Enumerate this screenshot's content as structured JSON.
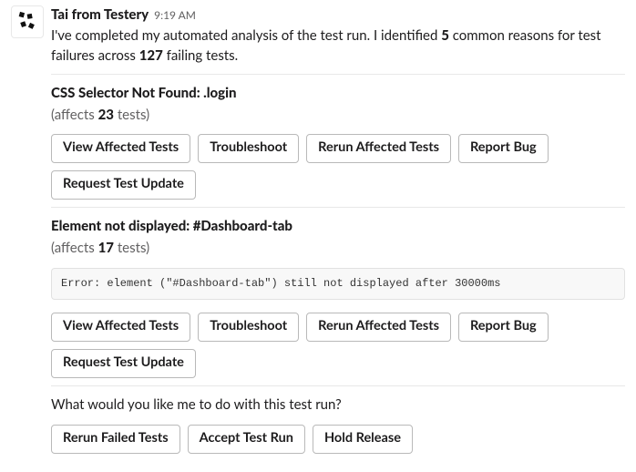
{
  "header": {
    "sender": "Tai from Testery",
    "timestamp": "9:19 AM"
  },
  "summary": {
    "prefix": "I've completed my automated analysis of the test run. I identified ",
    "reason_count": "5",
    "mid": " common reasons for test failures across ",
    "failing_count": "127",
    "suffix": " failing tests."
  },
  "section1": {
    "title": "CSS Selector Not Found: .login",
    "affects_prefix": "(affects ",
    "affects_count": "23",
    "affects_suffix": " tests)",
    "buttons": {
      "view": "View Affected Tests",
      "troubleshoot": "Troubleshoot",
      "rerun": "Rerun Affected Tests",
      "report": "Report Bug",
      "request": "Request Test Update"
    }
  },
  "section2": {
    "title": "Element not displayed: #Dashboard-tab",
    "affects_prefix": "(affects ",
    "affects_count": "17",
    "affects_suffix": " tests)",
    "error": "Error: element (\"#Dashboard-tab\") still not displayed after 30000ms",
    "buttons": {
      "view": "View Affected Tests",
      "troubleshoot": "Troubleshoot",
      "rerun": "Rerun Affected Tests",
      "report": "Report Bug",
      "request": "Request Test Update"
    }
  },
  "footer": {
    "question": "What would you like me to do with this test run?",
    "buttons": {
      "rerun_failed": "Rerun Failed Tests",
      "accept": "Accept Test Run",
      "hold": "Hold Release"
    }
  }
}
